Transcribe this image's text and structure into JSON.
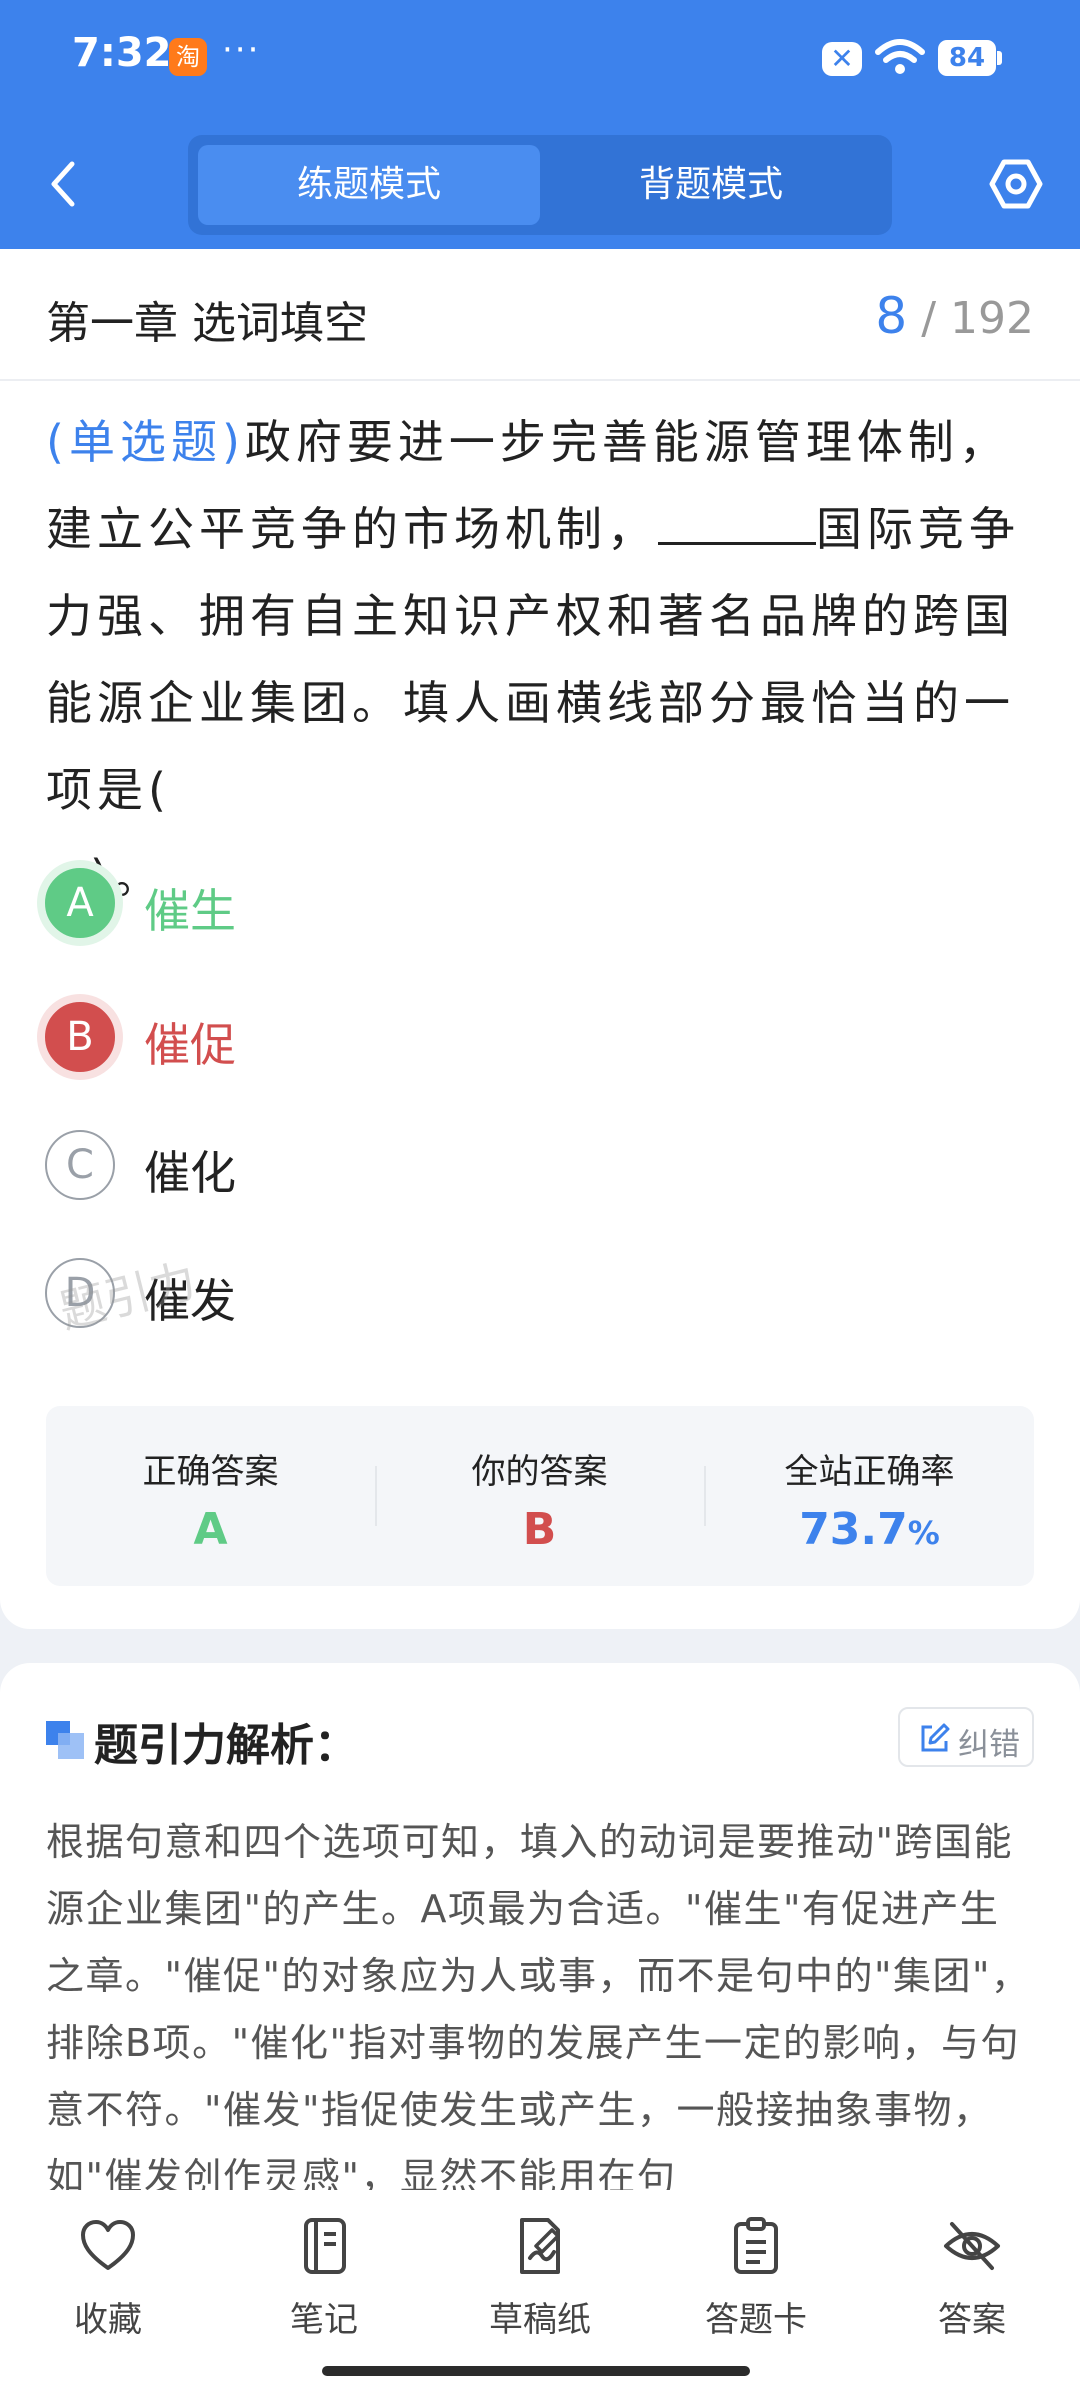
{
  "status_bar": {
    "time": "7:32",
    "app_badge_icon": "taobao-icon",
    "app_badge_text": "淘",
    "more": "···",
    "notification_icon": "close-x-icon",
    "notification_text": "✕",
    "battery": "84"
  },
  "header": {
    "tabs": [
      {
        "label": "练题模式",
        "active": true
      },
      {
        "label": "背题模式",
        "active": false
      }
    ]
  },
  "chapter": {
    "title": "第一章 选词填空",
    "current": "8",
    "separator": "/",
    "total": "192"
  },
  "question": {
    "type": "(单选题)",
    "text_before_blank": "政府要进一步完善能源管理体制，建立公平竞争的市场机制，",
    "text_after_blank": "国际竞争力强、拥有自主知识产权和著名品牌的跨国能源企业集团。填人画横线部分最恰当的一项是(",
    "text_close": ")。"
  },
  "options": [
    {
      "letter": "A",
      "text": "催生",
      "state": "correct"
    },
    {
      "letter": "B",
      "text": "催促",
      "state": "wrong"
    },
    {
      "letter": "C",
      "text": "催化",
      "state": "normal"
    },
    {
      "letter": "D",
      "text": "催发",
      "state": "normal"
    }
  ],
  "watermark": "题引力",
  "answer_summary": {
    "correct_label": "正确答案",
    "correct_value": "A",
    "yours_label": "你的答案",
    "yours_value": "B",
    "rate_label": "全站正确率",
    "rate_value": "73.7",
    "rate_unit": "%"
  },
  "explanation": {
    "title": "题引力解析：",
    "report_button": "纠错",
    "body": "根据句意和四个选项可知，填入的动词是要推动\"跨国能源企业集团\"的产生。A项最为合适。\"催生\"有促进产生之章。\"催促\"的对象应为人或事，而不是句中的\"集团\"，排除B项。\"催化\"指对事物的发展产生一定的影响，与句意不符。\"催发\"指促使发生或产生，一般接抽象事物，如\"催发创作灵感\"，显然不能用在句"
  },
  "toolbar": {
    "items": [
      {
        "label": "收藏",
        "icon": "heart-icon"
      },
      {
        "label": "笔记",
        "icon": "notebook-icon"
      },
      {
        "label": "草稿纸",
        "icon": "draft-paper-icon"
      },
      {
        "label": "答题卡",
        "icon": "answer-sheet-icon"
      },
      {
        "label": "答案",
        "icon": "eye-off-icon"
      }
    ]
  },
  "colors": {
    "primary": "#3d82ec",
    "correct": "#5fcb86",
    "wrong": "#d24e4e",
    "rate": "#3d82ec"
  }
}
